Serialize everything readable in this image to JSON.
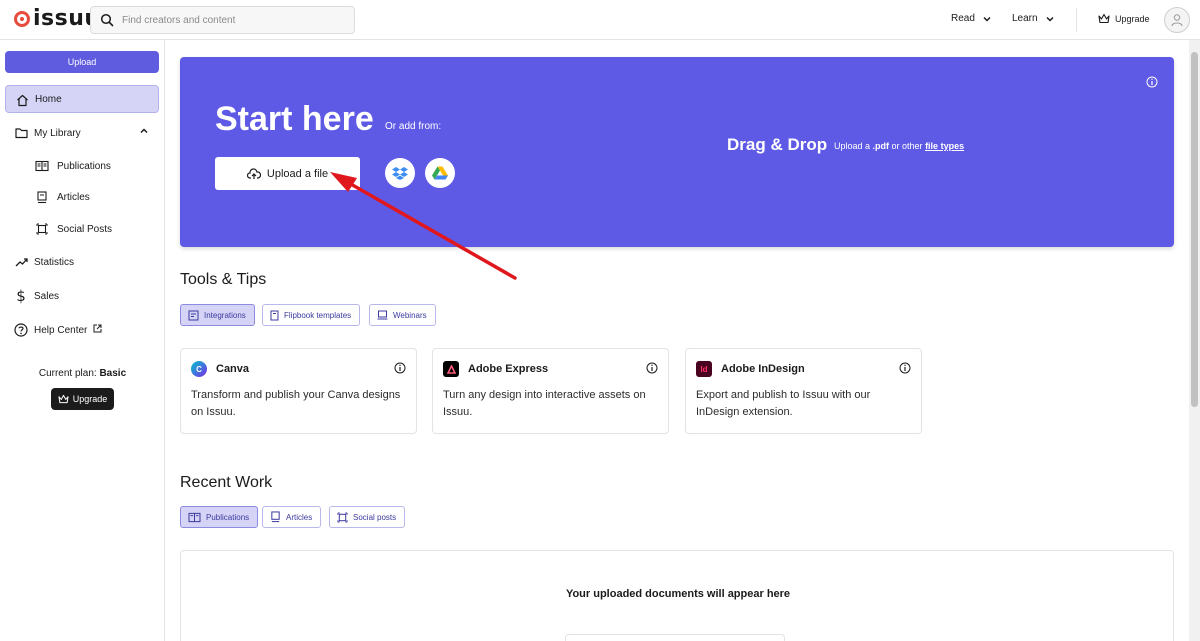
{
  "header": {
    "logo_text": "issuu",
    "search_placeholder": "Find creators and content",
    "nav": [
      {
        "label": "Read"
      },
      {
        "label": "Learn"
      }
    ],
    "upgrade_label": "Upgrade"
  },
  "sidebar": {
    "upload_label": "Upload",
    "items": [
      {
        "label": "Home",
        "icon": "home-icon"
      },
      {
        "label": "My Library",
        "icon": "folder-icon"
      },
      {
        "label": "Publications",
        "icon": "book-icon"
      },
      {
        "label": "Articles",
        "icon": "article-icon"
      },
      {
        "label": "Social Posts",
        "icon": "social-post-icon"
      },
      {
        "label": "Statistics",
        "icon": "trend-icon"
      },
      {
        "label": "Sales",
        "icon": "dollar-icon"
      },
      {
        "label": "Help Center",
        "icon": "help-icon"
      }
    ],
    "plan_prefix": "Current plan: ",
    "plan_name": "Basic",
    "upgrade_label": "Upgrade"
  },
  "hero": {
    "title": "Start here",
    "or_add": "Or add from:",
    "upload_file_label": "Upload a file",
    "drag_title": "Drag & Drop",
    "drag_prefix": "Upload a ",
    "drag_pdf": ".pdf",
    "drag_mid": " or other ",
    "drag_link": "file types",
    "colors": {
      "background": "#5e5ae6"
    }
  },
  "tools": {
    "title": "Tools & Tips",
    "chips": [
      {
        "label": "Integrations",
        "active": true
      },
      {
        "label": "Flipbook templates",
        "active": false
      },
      {
        "label": "Webinars",
        "active": false
      }
    ],
    "cards": [
      {
        "title": "Canva",
        "desc": "Transform and publish your Canva designs on Issuu.",
        "icon": "canva-logo-icon"
      },
      {
        "title": "Adobe Express",
        "desc": "Turn any design into interactive assets on Issuu.",
        "icon": "adobe-express-logo-icon"
      },
      {
        "title": "Adobe InDesign",
        "desc": "Export and publish to Issuu with our InDesign extension.",
        "icon": "indesign-logo-icon",
        "badge": "Id"
      }
    ]
  },
  "recent": {
    "title": "Recent Work",
    "chips": [
      {
        "label": "Publications",
        "active": true
      },
      {
        "label": "Articles",
        "active": false
      },
      {
        "label": "Social posts",
        "active": false
      }
    ],
    "empty_text": "Your uploaded documents will appear here"
  },
  "colors": {
    "accent": "#5f5ce0",
    "annotation_arrow": "#e0181e"
  }
}
